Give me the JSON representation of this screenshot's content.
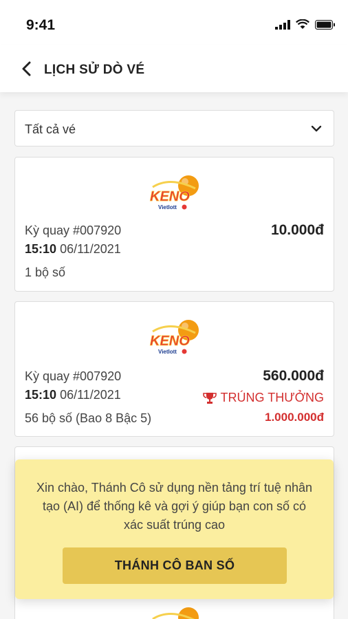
{
  "status": {
    "time": "9:41"
  },
  "header": {
    "title": "LỊCH SỬ DÒ VÉ"
  },
  "filter": {
    "value": "Tất cả vé"
  },
  "tickets": [
    {
      "draw": "Kỳ quay #007920",
      "time": "15:10",
      "date": "06/11/2021",
      "sets": "1 bộ số",
      "price": "10.000đ"
    },
    {
      "draw": "Kỳ quay #007920",
      "time": "15:10",
      "date": "06/11/2021",
      "sets": "56 bộ số (Bao 8 Bậc 5)",
      "price": "560.000đ",
      "win_label": "TRÚNG THƯỞNG",
      "win_amount": "1.000.000đ"
    }
  ],
  "logo": {
    "text": "KENO",
    "brand": "Vietlott"
  },
  "promo": {
    "text": "Xin chào, Thánh Cô sử dụng nền tảng trí tuệ nhân tạo (AI) để thống kê và gợi ý giúp bạn con số có xác suất trúng cao",
    "button": "THÁNH CÔ BAN SỐ"
  },
  "colors": {
    "win": "#d32f2f",
    "promo_bg": "#fbeea0",
    "promo_button": "#e6c654",
    "keno_orange": "#f39c12"
  },
  "icons": [
    "signal-icon",
    "wifi-icon",
    "battery-icon",
    "back-arrow-icon",
    "chevron-down-icon",
    "trophy-icon",
    "keno-logo"
  ]
}
